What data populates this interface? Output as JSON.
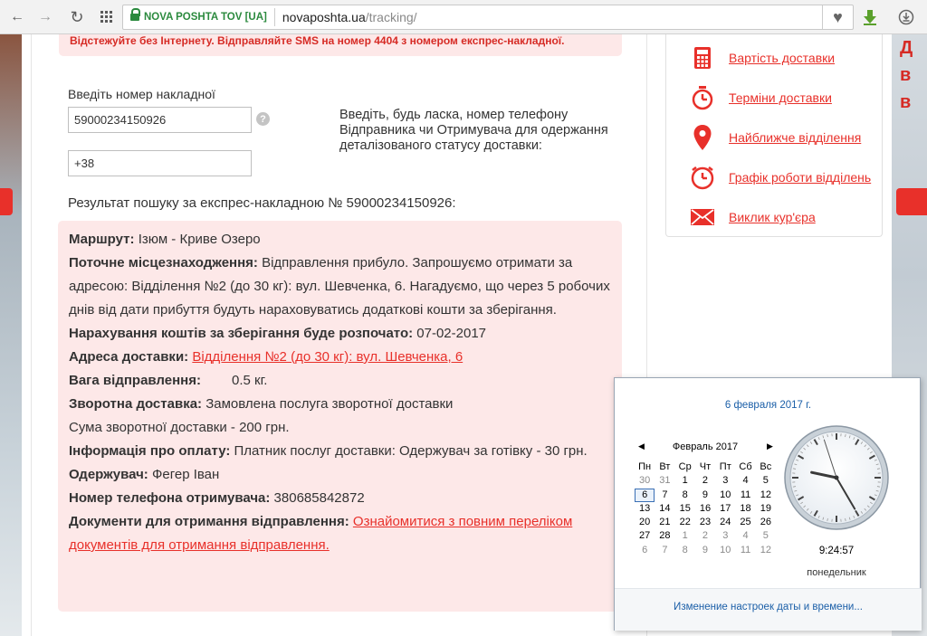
{
  "browser": {
    "secure_label": "NOVA POSHTA TOV [UA]",
    "url_host": "novaposhta.ua",
    "url_path": "/tracking/"
  },
  "banner": {
    "text": "Відстежуйте без Інтернету. Відправляйте SMS на номер 4404 з номером експрес-накладної."
  },
  "form": {
    "invoice_label": "Введіть номер накладної",
    "invoice_value": "59000234150926",
    "phone_value": "+38",
    "help_glyph": "?",
    "instruction": "Введіть, будь ласка, номер телефону Відправника чи Отримувача для одержання деталізованого статусу доставки:"
  },
  "result": {
    "title": "Результат пошуку за експрес-накладною № 59000234150926:",
    "route_label": "Маршрут:",
    "route_value": " Ізюм - Криве Озеро",
    "location_label": "Поточне місцезнаходження:",
    "location_value": " Відправлення прибуло. Запрошуємо отримати за адресою: Відділення №2 (до 30 кг): вул. Шевченка, 6. Нагадуємо, що через 5 робочих днів від дати прибуття будуть нараховуватись додаткові кошти за зберігання.",
    "storage_label": "Нарахування коштів за зберігання буде розпочато:",
    "storage_value": " 07-02-2017",
    "address_label": "Адреса доставки:",
    "address_link": "Відділення №2 (до 30 кг): вул. Шевченка, 6",
    "weight_label": "Вага відправлення:",
    "weight_value": "0.5 кг.",
    "return_label": "Зворотна доставка:",
    "return_value": " Замовлена послуга зворотної доставки",
    "return_sum": "Сума зворотної доставки - 200 грн.",
    "payment_label": "Інформація про оплату:",
    "payment_value": " Платник послуг доставки: Одержувач за готівку - 30 грн.",
    "recipient_label": "Одержувач:",
    "recipient_value": " Фегер Іван",
    "phone_label": "Номер телефона отримувача:",
    "phone_value": " 380685842872",
    "docs_label": "Документи для отримання відправлення:",
    "docs_link": "Ознайомитися з повним переліком документів для отримання відправлення."
  },
  "menu": {
    "items": [
      {
        "label": "Вартість доставки",
        "icon": "calculator-icon"
      },
      {
        "label": "Терміни доставки",
        "icon": "stopwatch-icon"
      },
      {
        "label": "Найближче відділення",
        "icon": "map-pin-icon"
      },
      {
        "label": "Графік роботи відділень",
        "icon": "clock-icon"
      },
      {
        "label": "Виклик кур'єра",
        "icon": "envelope-icon"
      }
    ],
    "accent_color": "#e8302a"
  },
  "promo_letters": [
    "Д",
    "в",
    "в"
  ],
  "calendar": {
    "full_date": "6 февраля 2017 г.",
    "month_title": "Февраль 2017",
    "weekdays": [
      "Пн",
      "Вт",
      "Ср",
      "Чт",
      "Пт",
      "Сб",
      "Вс"
    ],
    "weeks": [
      [
        "30",
        "31",
        "1",
        "2",
        "3",
        "4",
        "5"
      ],
      [
        "6",
        "7",
        "8",
        "9",
        "10",
        "11",
        "12"
      ],
      [
        "13",
        "14",
        "15",
        "16",
        "17",
        "18",
        "19"
      ],
      [
        "20",
        "21",
        "22",
        "23",
        "24",
        "25",
        "26"
      ],
      [
        "27",
        "28",
        "1",
        "2",
        "3",
        "4",
        "5"
      ],
      [
        "6",
        "7",
        "8",
        "9",
        "10",
        "11",
        "12"
      ]
    ],
    "today": "6",
    "time": "9:24:57",
    "weekday_name": "понедельник",
    "footer_link": "Изменение настроек даты и времени...",
    "clock_value": {
      "hours": 9,
      "minutes": 24,
      "seconds": 57
    }
  }
}
